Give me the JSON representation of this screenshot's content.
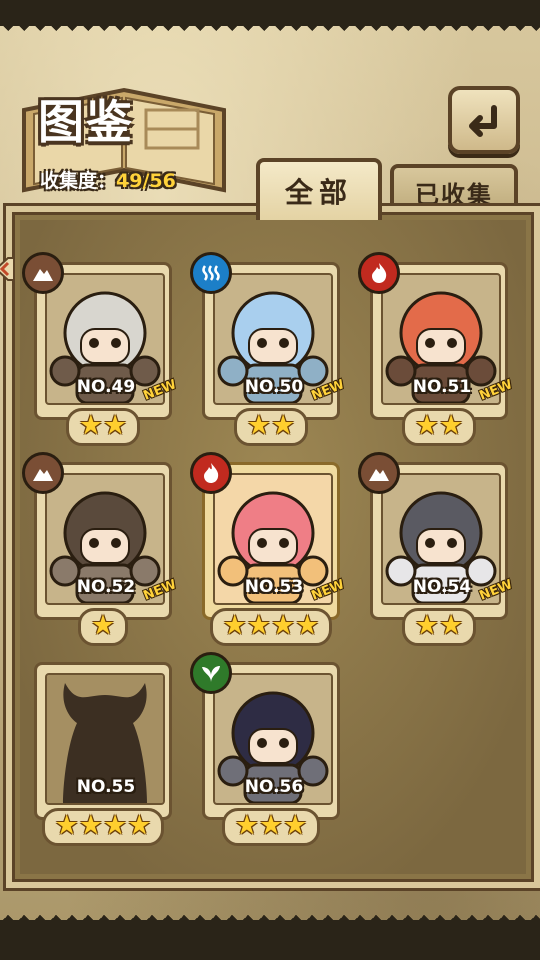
{
  "header": {
    "title": "图鉴",
    "progress_label": "收集度：",
    "progress_value": "49/56"
  },
  "tabs": [
    {
      "label": "全部",
      "active": true
    },
    {
      "label": "已收集",
      "active": false
    }
  ],
  "cards": [
    {
      "number": "NO.49",
      "element": "earth-icon",
      "stars": "★★",
      "new": "NEW",
      "hair": "#d8d6cf",
      "body": "#6f5b4a"
    },
    {
      "number": "NO.50",
      "element": "water-icon",
      "stars": "★★",
      "new": "NEW",
      "hair": "#a9cfee",
      "body": "#8fb0c6"
    },
    {
      "number": "NO.51",
      "element": "fire-icon",
      "stars": "★★",
      "new": "NEW",
      "hair": "#e36b4a",
      "body": "#6b4c3a"
    },
    {
      "number": "NO.52",
      "element": "earth-icon",
      "stars": "★",
      "new": "NEW",
      "hair": "#5a4a3c",
      "body": "#8a7a6a"
    },
    {
      "number": "NO.53",
      "element": "fire-icon",
      "stars": "★★★★",
      "new": "NEW",
      "hair": "#ef7e86",
      "body": "#f2c07a"
    },
    {
      "number": "NO.54",
      "element": "earth-icon",
      "stars": "★★",
      "new": "NEW",
      "hair": "#5a5a62",
      "body": "#e7e6e8"
    },
    {
      "number": "NO.55",
      "element": "",
      "stars": "★★★★",
      "new": "",
      "hair": "#3c2f22",
      "body": "#3c2f22"
    },
    {
      "number": "NO.56",
      "element": "plant-icon",
      "stars": "★★★",
      "new": "",
      "hair": "#2e2c44",
      "body": "#6f6f78"
    }
  ],
  "colors": {
    "accent": "#ffd23a",
    "frame": "#6b5331",
    "panel": "#8a7547"
  }
}
